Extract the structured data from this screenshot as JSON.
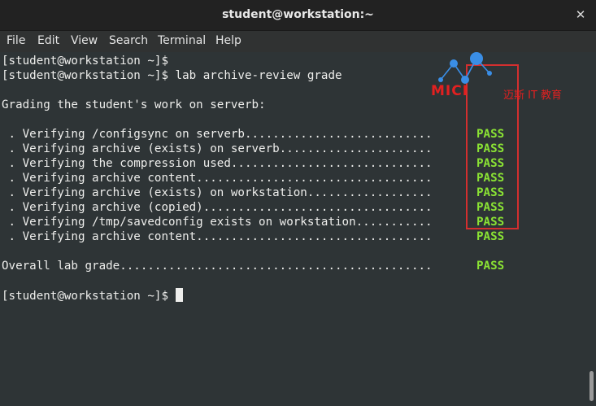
{
  "window": {
    "title": "student@workstation:~"
  },
  "menu": [
    "File",
    "Edit",
    "View",
    "Search",
    "Terminal",
    "Help"
  ],
  "terminal": {
    "lines": [
      "[student@workstation ~]$",
      "[student@workstation ~]$ lab archive-review grade",
      "",
      "Grading the student's work on serverb:",
      "",
      " . Verifying /configsync on serverb...........................",
      " . Verifying archive (exists) on serverb......................",
      " . Verifying the compression used.............................",
      " . Verifying archive content..................................",
      " . Verifying archive (exists) on workstation..................",
      " . Verifying archive (copied).................................",
      " . Verifying /tmp/savedconfig exists on workstation...........",
      " . Verifying archive content..................................",
      "",
      "Overall lab grade.............................................",
      "",
      "[student@workstation ~]$ "
    ],
    "results": [
      {
        "line": 5,
        "status": "PASS"
      },
      {
        "line": 6,
        "status": "PASS"
      },
      {
        "line": 7,
        "status": "PASS"
      },
      {
        "line": 8,
        "status": "PASS"
      },
      {
        "line": 9,
        "status": "PASS"
      },
      {
        "line": 10,
        "status": "PASS"
      },
      {
        "line": 11,
        "status": "PASS"
      },
      {
        "line": 12,
        "status": "PASS"
      },
      {
        "line": 14,
        "status": "PASS"
      }
    ]
  },
  "watermark": {
    "brand": "MICI",
    "tagline": "迈斯 IT 教育"
  },
  "colors": {
    "pass": "#8ae234",
    "highlight": "#d32f2f",
    "terminal_bg": "#2e3436"
  }
}
